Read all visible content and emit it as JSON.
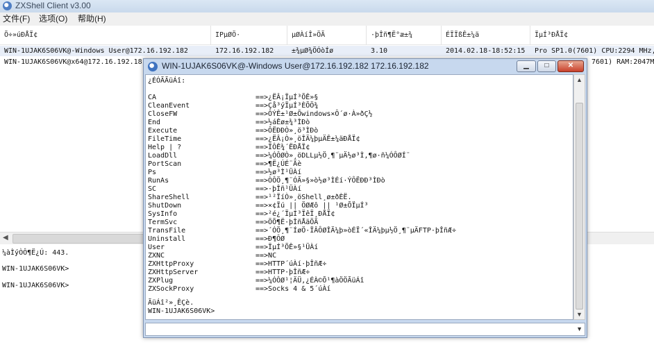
{
  "app": {
    "title": "ZXShell Client v3.00"
  },
  "menu": [
    "文件(F)",
    "选项(O)",
    "帮助(H)"
  ],
  "list": {
    "columns": [
      "Õ÷»úÐÅÏ¢",
      "IPµØÖ·",
      "µØÀíÎ»ÖÃ",
      "·þÎñ¶Ë°æ±¾",
      "ÉÏÏßÊ±¼ä",
      "ÏµÍ³ÐÅÏ¢"
    ],
    "rows": [
      [
        "WIN-1UJAK6S06VK@-Windows User@172.16.192.182",
        "172.16.192.182",
        "±¾µØ¾ÖÓòÍø",
        "3.10",
        "2014.02.18-18:52:15",
        "Pro SP1.0(7601) CPU:2294 MHz,"
      ],
      [
        "WIN-1UJAK6S06VK@x64@172.16.192.18",
        "",
        "",
        "",
        "",
        "7601) RAM:2047MB,"
      ]
    ]
  },
  "console": {
    "lines": [
      "¼àÌýÒÔ¶Ë¿Ú: 443.",
      "WIN-1UJAK6S06VK>",
      "WIN-1UJAK6S06VK>"
    ]
  },
  "shell_window": {
    "title": "WIN-1UJAK6S06VK@-Windows User@172.16.192.182 172.16.192.182",
    "header": "¿ÉÓÃÃüÁî:",
    "commands": [
      {
        "name": "CA",
        "desc": "==>¿ËÂ¡ÏµÍ³ÕÊ»§"
      },
      {
        "name": "CleanEvent",
        "desc": "==>Çå³ýÏµÍ³ÈÕÖ¾"
      },
      {
        "name": "CloseFW",
        "desc": "==>ÔÝÊ±¹Ø±Õwindows×Ô´ø·À»ðÇ½"
      },
      {
        "name": "End",
        "desc": "==>½áÊø±¾³ÌÐò"
      },
      {
        "name": "Execute",
        "desc": "==>ÔËÐÐÒ»¸ö³ÌÐò"
      },
      {
        "name": "FileTime",
        "desc": "==>¿ËÂ¡Ò»¸öÎÄ¼þµÄÊ±¼äÐÅÏ¢"
      },
      {
        "name": "Help | ?",
        "desc": "==>ÏÔÊ¾´ËÐÅÏ¢"
      },
      {
        "name": "LoadDll",
        "desc": "==>¼ÓÔØÒ»¸öDLLµ½Ö¸¶¨µÄ½ø³Ì,¶ø·ñ¼ÓÔØÍ¨"
      },
      {
        "name": "PortScan",
        "desc": "==>¶Ë¿ÚÉ¨Ãè"
      },
      {
        "name": "Ps",
        "desc": "==>½ø³Ì¹ÜÀí"
      },
      {
        "name": "RunAs",
        "desc": "==>ÒÔÖ¸¶¨ÓÃ»§»ò½ø³ÌÉí·ÝÔËÐÐ³ÌÐò"
      },
      {
        "name": "SC",
        "desc": "==>·þÎñ¹ÜÀí"
      },
      {
        "name": "ShareShell",
        "desc": "==>¹²ÏíÒ»¸öShell¸ø±ðÈË."
      },
      {
        "name": "ShutDown",
        "desc": "==>×¢Ïú || ÖØÆô || ¹Ø±ÕÏµÍ³"
      },
      {
        "name": "SysInfo",
        "desc": "==>²é¿´ÏµÍ³ÏêÏ¸ÐÅÏ¢"
      },
      {
        "name": "TermSvc",
        "desc": "==>ÖÕ¶Ë·þÎñÅäÖÃ"
      },
      {
        "name": "TransFile",
        "desc": "==>´ÓÖ¸¶¨ÍøÖ·ÏÂÔØÎÄ¼þ»òÉÏ´«ÎÄ¼þµ½Ö¸¶¨µÄFTP·þÎñÆ÷"
      },
      {
        "name": "Uninstall",
        "desc": "==>Ð¶ÔØ"
      },
      {
        "name": "User",
        "desc": "==>ÏµÍ³ÕÊ»§¹ÜÀí"
      },
      {
        "name": "ZXNC",
        "desc": "==>NC"
      },
      {
        "name": "ZXHttpProxy",
        "desc": "==>HTTP´úÀí·þÎñÆ÷"
      },
      {
        "name": "ZXHttpServer",
        "desc": "==>HTTP·þÎñÆ÷"
      },
      {
        "name": "ZXPlug",
        "desc": "==>¼ÓÔØ¹¦ÄÜ,¿ÉÀ©Õ¹¶àÖÖÃüÁî"
      },
      {
        "name": "ZXSockProxy",
        "desc": "==>Socks 4 & 5´úÀí"
      }
    ],
    "footer": "ÃüÁî²»¸ÊÇè.",
    "prompt": "WIN-1UJAK6S06VK>",
    "input_value": ""
  }
}
